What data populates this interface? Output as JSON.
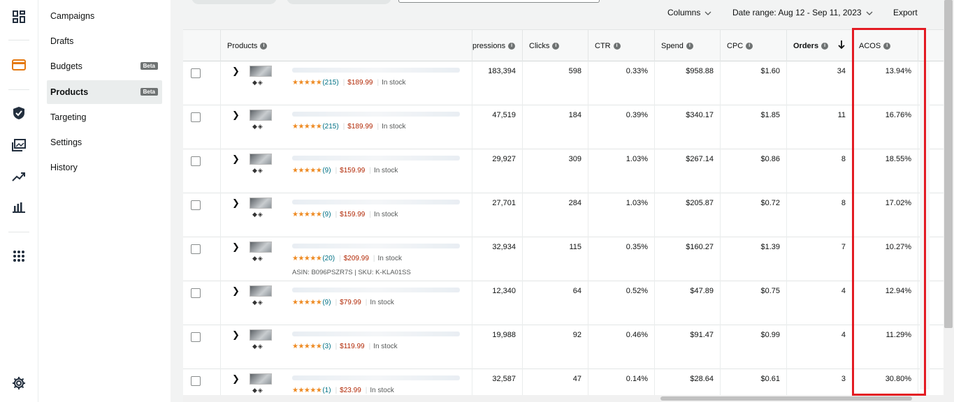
{
  "nav": {
    "items": [
      {
        "label": "Campaigns"
      },
      {
        "label": "Drafts"
      },
      {
        "label": "Budgets",
        "badge": "Beta"
      },
      {
        "label": "Products",
        "badge": "Beta"
      },
      {
        "label": "Targeting"
      },
      {
        "label": "Settings"
      },
      {
        "label": "History"
      }
    ]
  },
  "toolbar": {
    "columns_label": "Columns",
    "date_range_label": "Date range: Aug 12 - Sep 11, 2023",
    "export_label": "Export"
  },
  "table": {
    "headers": {
      "products": "Products",
      "impressions": "pressions",
      "clicks": "Clicks",
      "ctr": "CTR",
      "spend": "Spend",
      "cpc": "CPC",
      "orders": "Orders",
      "acos": "ACOS"
    },
    "rows": [
      {
        "rating": "(215)",
        "price": "$189.99",
        "stock": "In stock",
        "asin": "",
        "impressions": "183,394",
        "clicks": "598",
        "ctr": "0.33%",
        "spend": "$958.88",
        "cpc": "$1.60",
        "orders": "34",
        "acos": "13.94%"
      },
      {
        "rating": "(215)",
        "price": "$189.99",
        "stock": "In stock",
        "asin": "",
        "impressions": "47,519",
        "clicks": "184",
        "ctr": "0.39%",
        "spend": "$340.17",
        "cpc": "$1.85",
        "orders": "11",
        "acos": "16.76%"
      },
      {
        "rating": "(9)",
        "price": "$159.99",
        "stock": "In stock",
        "asin": "",
        "impressions": "29,927",
        "clicks": "309",
        "ctr": "1.03%",
        "spend": "$267.14",
        "cpc": "$0.86",
        "orders": "8",
        "acos": "18.55%"
      },
      {
        "rating": "(9)",
        "price": "$159.99",
        "stock": "In stock",
        "asin": "",
        "impressions": "27,701",
        "clicks": "284",
        "ctr": "1.03%",
        "spend": "$205.87",
        "cpc": "$0.72",
        "orders": "8",
        "acos": "17.02%"
      },
      {
        "rating": "(20)",
        "price": "$209.99",
        "stock": "In stock",
        "asin": "ASIN: B096PSZR7S  |  SKU: K-KLA01SS",
        "impressions": "32,934",
        "clicks": "115",
        "ctr": "0.35%",
        "spend": "$160.27",
        "cpc": "$1.39",
        "orders": "7",
        "acos": "10.27%"
      },
      {
        "rating": "(9)",
        "price": "$79.99",
        "stock": "In stock",
        "asin": "",
        "impressions": "12,340",
        "clicks": "64",
        "ctr": "0.52%",
        "spend": "$47.89",
        "cpc": "$0.75",
        "orders": "4",
        "acos": "12.94%"
      },
      {
        "rating": "(3)",
        "price": "$119.99",
        "stock": "In stock",
        "asin": "",
        "impressions": "19,988",
        "clicks": "92",
        "ctr": "0.46%",
        "spend": "$91.47",
        "cpc": "$0.99",
        "orders": "4",
        "acos": "11.29%"
      },
      {
        "rating": "(1)",
        "price": "$23.99",
        "stock": "In stock",
        "asin": "",
        "impressions": "32,587",
        "clicks": "47",
        "ctr": "0.14%",
        "spend": "$28.64",
        "cpc": "$0.61",
        "orders": "3",
        "acos": "30.80%"
      }
    ]
  },
  "colors": {
    "highlight": "#e31b23",
    "price": "#b12704",
    "star": "#ee8a22",
    "link": "#007185",
    "accent": "#e47911"
  }
}
